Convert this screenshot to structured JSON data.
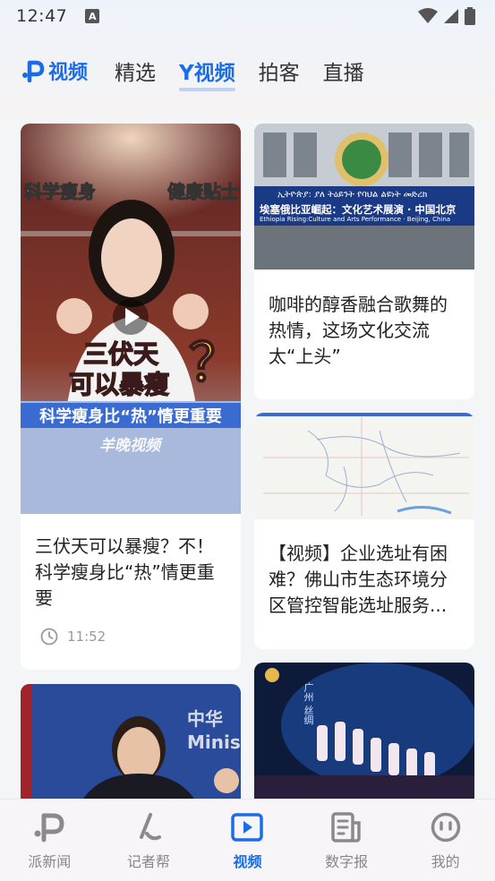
{
  "status": {
    "time": "12:47",
    "a_badge": "A"
  },
  "header": {
    "brand_label": "视频",
    "tabs": [
      {
        "label": "精选",
        "active": false
      },
      {
        "label": "Y视频",
        "active": true
      },
      {
        "label": "拍客",
        "active": false
      },
      {
        "label": "直播",
        "active": false
      }
    ]
  },
  "cards": [
    {
      "title": "三伏天可以暴瘦？不！科学瘦身比“热”情更重要",
      "duration": "11:52",
      "overlay": {
        "top_left": "科学瘦身",
        "top_right": "健康贴士",
        "headline_1": "三伏天",
        "headline_2": "可以暴瘦",
        "qmark": "？",
        "banner": "科学瘦身比“热”情更重要",
        "watermark": "羊晚视频"
      }
    },
    {
      "title": "咖啡的醇香融合歌舞的热情，这场文化交流太“上头”",
      "banner_line1": "ኢትዮጵያ: ያለ ትዕይንት የባህል ልዩነት መድረክ",
      "banner_line2": "埃塞俄比亚崛起：文化艺术展演 · 中国北京",
      "banner_line3": "Ethiopia Rising:Culture and Arts Performance · Beijing, China"
    },
    {
      "title": "【视频】企业选址有困难？佛山市生态环境分区管控智能选址服务..."
    },
    {
      "title": "",
      "overlay_text": "中华\nMinis"
    },
    {
      "title": "",
      "overlay_text": "广州 丝绸"
    }
  ],
  "bottom_nav": [
    {
      "label": "派新闻",
      "icon": "pai-logo-icon",
      "active": false
    },
    {
      "label": "记者帮",
      "icon": "reporter-pen-icon",
      "active": false
    },
    {
      "label": "视频",
      "icon": "video-play-icon",
      "active": true
    },
    {
      "label": "数字报",
      "icon": "newspaper-icon",
      "active": false
    },
    {
      "label": "我的",
      "icon": "profile-face-icon",
      "active": false
    }
  ],
  "colors": {
    "accent": "#1a6ce8",
    "inactive": "#888888"
  }
}
